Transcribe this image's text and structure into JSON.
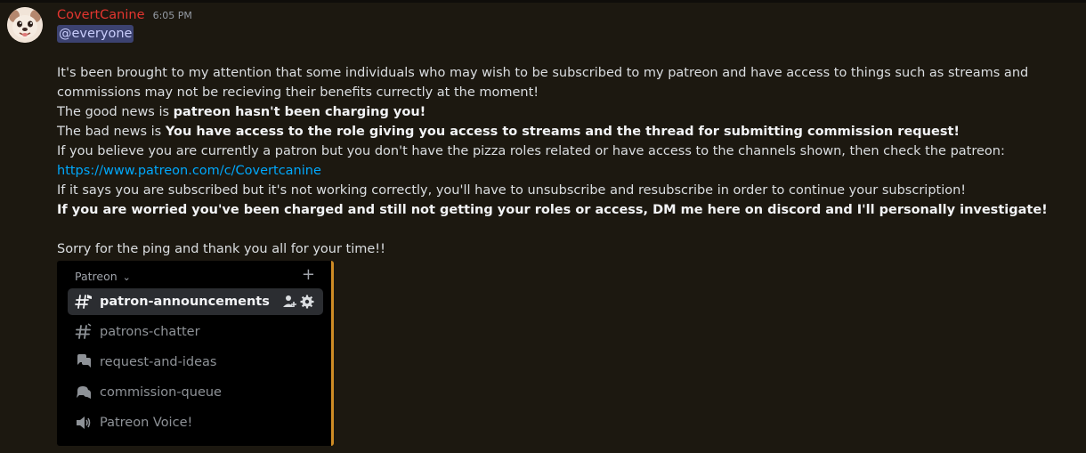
{
  "colors": {
    "background": "#1c1810",
    "username": "#e3352f",
    "mention_bg": "#3c4270",
    "link": "#00a8fc",
    "embed_accent": "#ce8b25"
  },
  "message": {
    "author": "CovertCanine",
    "timestamp": "6:05 PM",
    "mention": "@everyone",
    "line1": "It's been brought to my attention that some individuals who may wish to be subscribed to my patreon and have access to things such as streams and commissions may not be recieving their benefits currectly at the moment!",
    "line2_prefix": "The good news is ",
    "line2_bold": "patreon hasn't been charging you!",
    "line3_prefix": "The bad news is ",
    "line3_bold": "You have access to the role giving you access to streams and the thread for submitting commission request!",
    "line4": "If you believe you are currently a patron but you don't have the pizza roles related or have access to the channels shown, then check the patreon:",
    "link": "https://www.patreon.com/c/Covertcanine",
    "line5": "If it says you are subscribed but it's not working correctly, you'll have to unsubscribe and resubscribe in order to continue your subscription!",
    "line6_bold": "If you are worried you've been charged and still not getting your roles or access, DM me here on discord and I'll personally investigate!",
    "line7": "Sorry for the ping and thank you all for your time!!"
  },
  "embed": {
    "category": "Patreon",
    "category_chevron": "⌄",
    "add_symbol": "+",
    "channels": [
      {
        "label": "patron-announcements",
        "icon": "announcement-hash-icon"
      },
      {
        "label": "patrons-chatter",
        "icon": "hash-icon"
      },
      {
        "label": "request-and-ideas",
        "icon": "forum-icon"
      },
      {
        "label": "commission-queue",
        "icon": "forum-icon"
      },
      {
        "label": "Patreon Voice!",
        "icon": "voice-speaker-icon"
      }
    ]
  }
}
